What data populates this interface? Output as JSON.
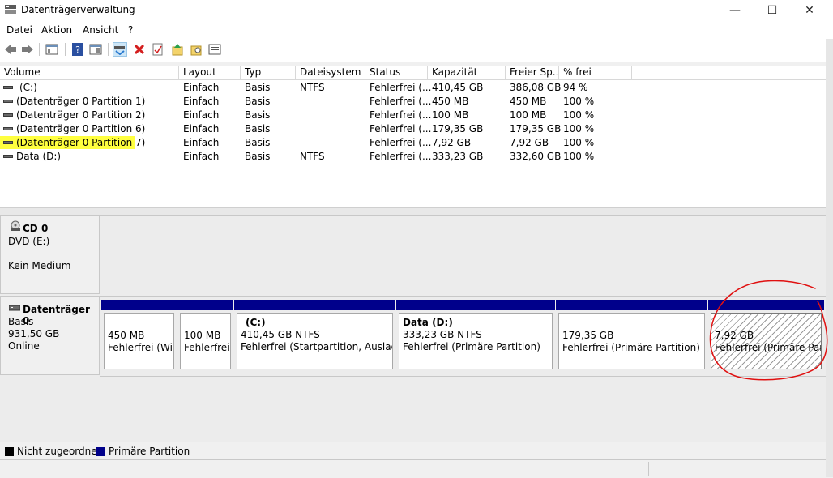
{
  "window": {
    "title": "Datenträgerverwaltung",
    "minimize_label": "—",
    "maximize_label": "☐",
    "close_label": "✕"
  },
  "menu": [
    "Datei",
    "Aktion",
    "Ansicht",
    "?"
  ],
  "toolbar_icons": [
    "back-icon",
    "forward-icon",
    "console-tree-icon",
    "help-icon",
    "action-pane-icon",
    "connect-drive-icon",
    "delete-icon",
    "properties-icon",
    "open-icon",
    "explore-icon",
    "settings-icon"
  ],
  "columns": [
    "Volume",
    "Layout",
    "Typ",
    "Dateisystem",
    "Status",
    "Kapazität",
    "Freier Sp...",
    "% frei"
  ],
  "volumes": [
    {
      "name": "(C:)",
      "layout": "Einfach",
      "typ": "Basis",
      "fs": "NTFS",
      "status": "Fehlerfrei (...",
      "cap": "410,45 GB",
      "free": "386,08 GB",
      "pct": "94 %"
    },
    {
      "name": "(Datenträger 0 Partition 1)",
      "layout": "Einfach",
      "typ": "Basis",
      "fs": "",
      "status": "Fehlerfrei (...",
      "cap": "450 MB",
      "free": "450 MB",
      "pct": "100 %"
    },
    {
      "name": "(Datenträger 0 Partition 2)",
      "layout": "Einfach",
      "typ": "Basis",
      "fs": "",
      "status": "Fehlerfrei (...",
      "cap": "100 MB",
      "free": "100 MB",
      "pct": "100 %"
    },
    {
      "name": "(Datenträger 0 Partition 6)",
      "layout": "Einfach",
      "typ": "Basis",
      "fs": "",
      "status": "Fehlerfrei (...",
      "cap": "179,35 GB",
      "free": "179,35 GB",
      "pct": "100 %"
    },
    {
      "name": "(Datenträger 0 Partition 7)",
      "layout": "Einfach",
      "typ": "Basis",
      "fs": "",
      "status": "Fehlerfrei (...",
      "cap": "7,92 GB",
      "free": "7,92 GB",
      "pct": "100 %"
    },
    {
      "name": "Data (D:)",
      "layout": "Einfach",
      "typ": "Basis",
      "fs": "NTFS",
      "status": "Fehlerfrei (...",
      "cap": "333,23 GB",
      "free": "332,60 GB",
      "pct": "100 %"
    }
  ],
  "cd0": {
    "title": "CD 0",
    "line1": "DVD (E:)",
    "line2": "Kein Medium"
  },
  "disk0": {
    "title": "Datenträger 0",
    "type": "Basis",
    "size": "931,50 GB",
    "state": "Online"
  },
  "partitions": [
    {
      "name": "",
      "size": "450 MB",
      "status": "Fehlerfrei (Wie"
    },
    {
      "name": "",
      "size": "100 MB",
      "status": "Fehlerfrei ("
    },
    {
      "name": "(C:)",
      "size": "410,45 GB NTFS",
      "status": "Fehlerfrei (Startpartition, Auslageru"
    },
    {
      "name": "Data  (D:)",
      "size": "333,23 GB NTFS",
      "status": "Fehlerfrei (Primäre Partition)"
    },
    {
      "name": "",
      "size": "179,35 GB",
      "status": "Fehlerfrei (Primäre Partition)"
    },
    {
      "name": "",
      "size": "7,92 GB",
      "status": "Fehlerfrei (Primäre Partit"
    }
  ],
  "legend": [
    {
      "label": "Nicht zugeordnet",
      "color": "#000000"
    },
    {
      "label": "Primäre Partition",
      "color": "#00008b"
    }
  ],
  "colors": {
    "highlight": "#ffff3f",
    "annotation": "#e01010",
    "partition_bar": "#00008b"
  }
}
